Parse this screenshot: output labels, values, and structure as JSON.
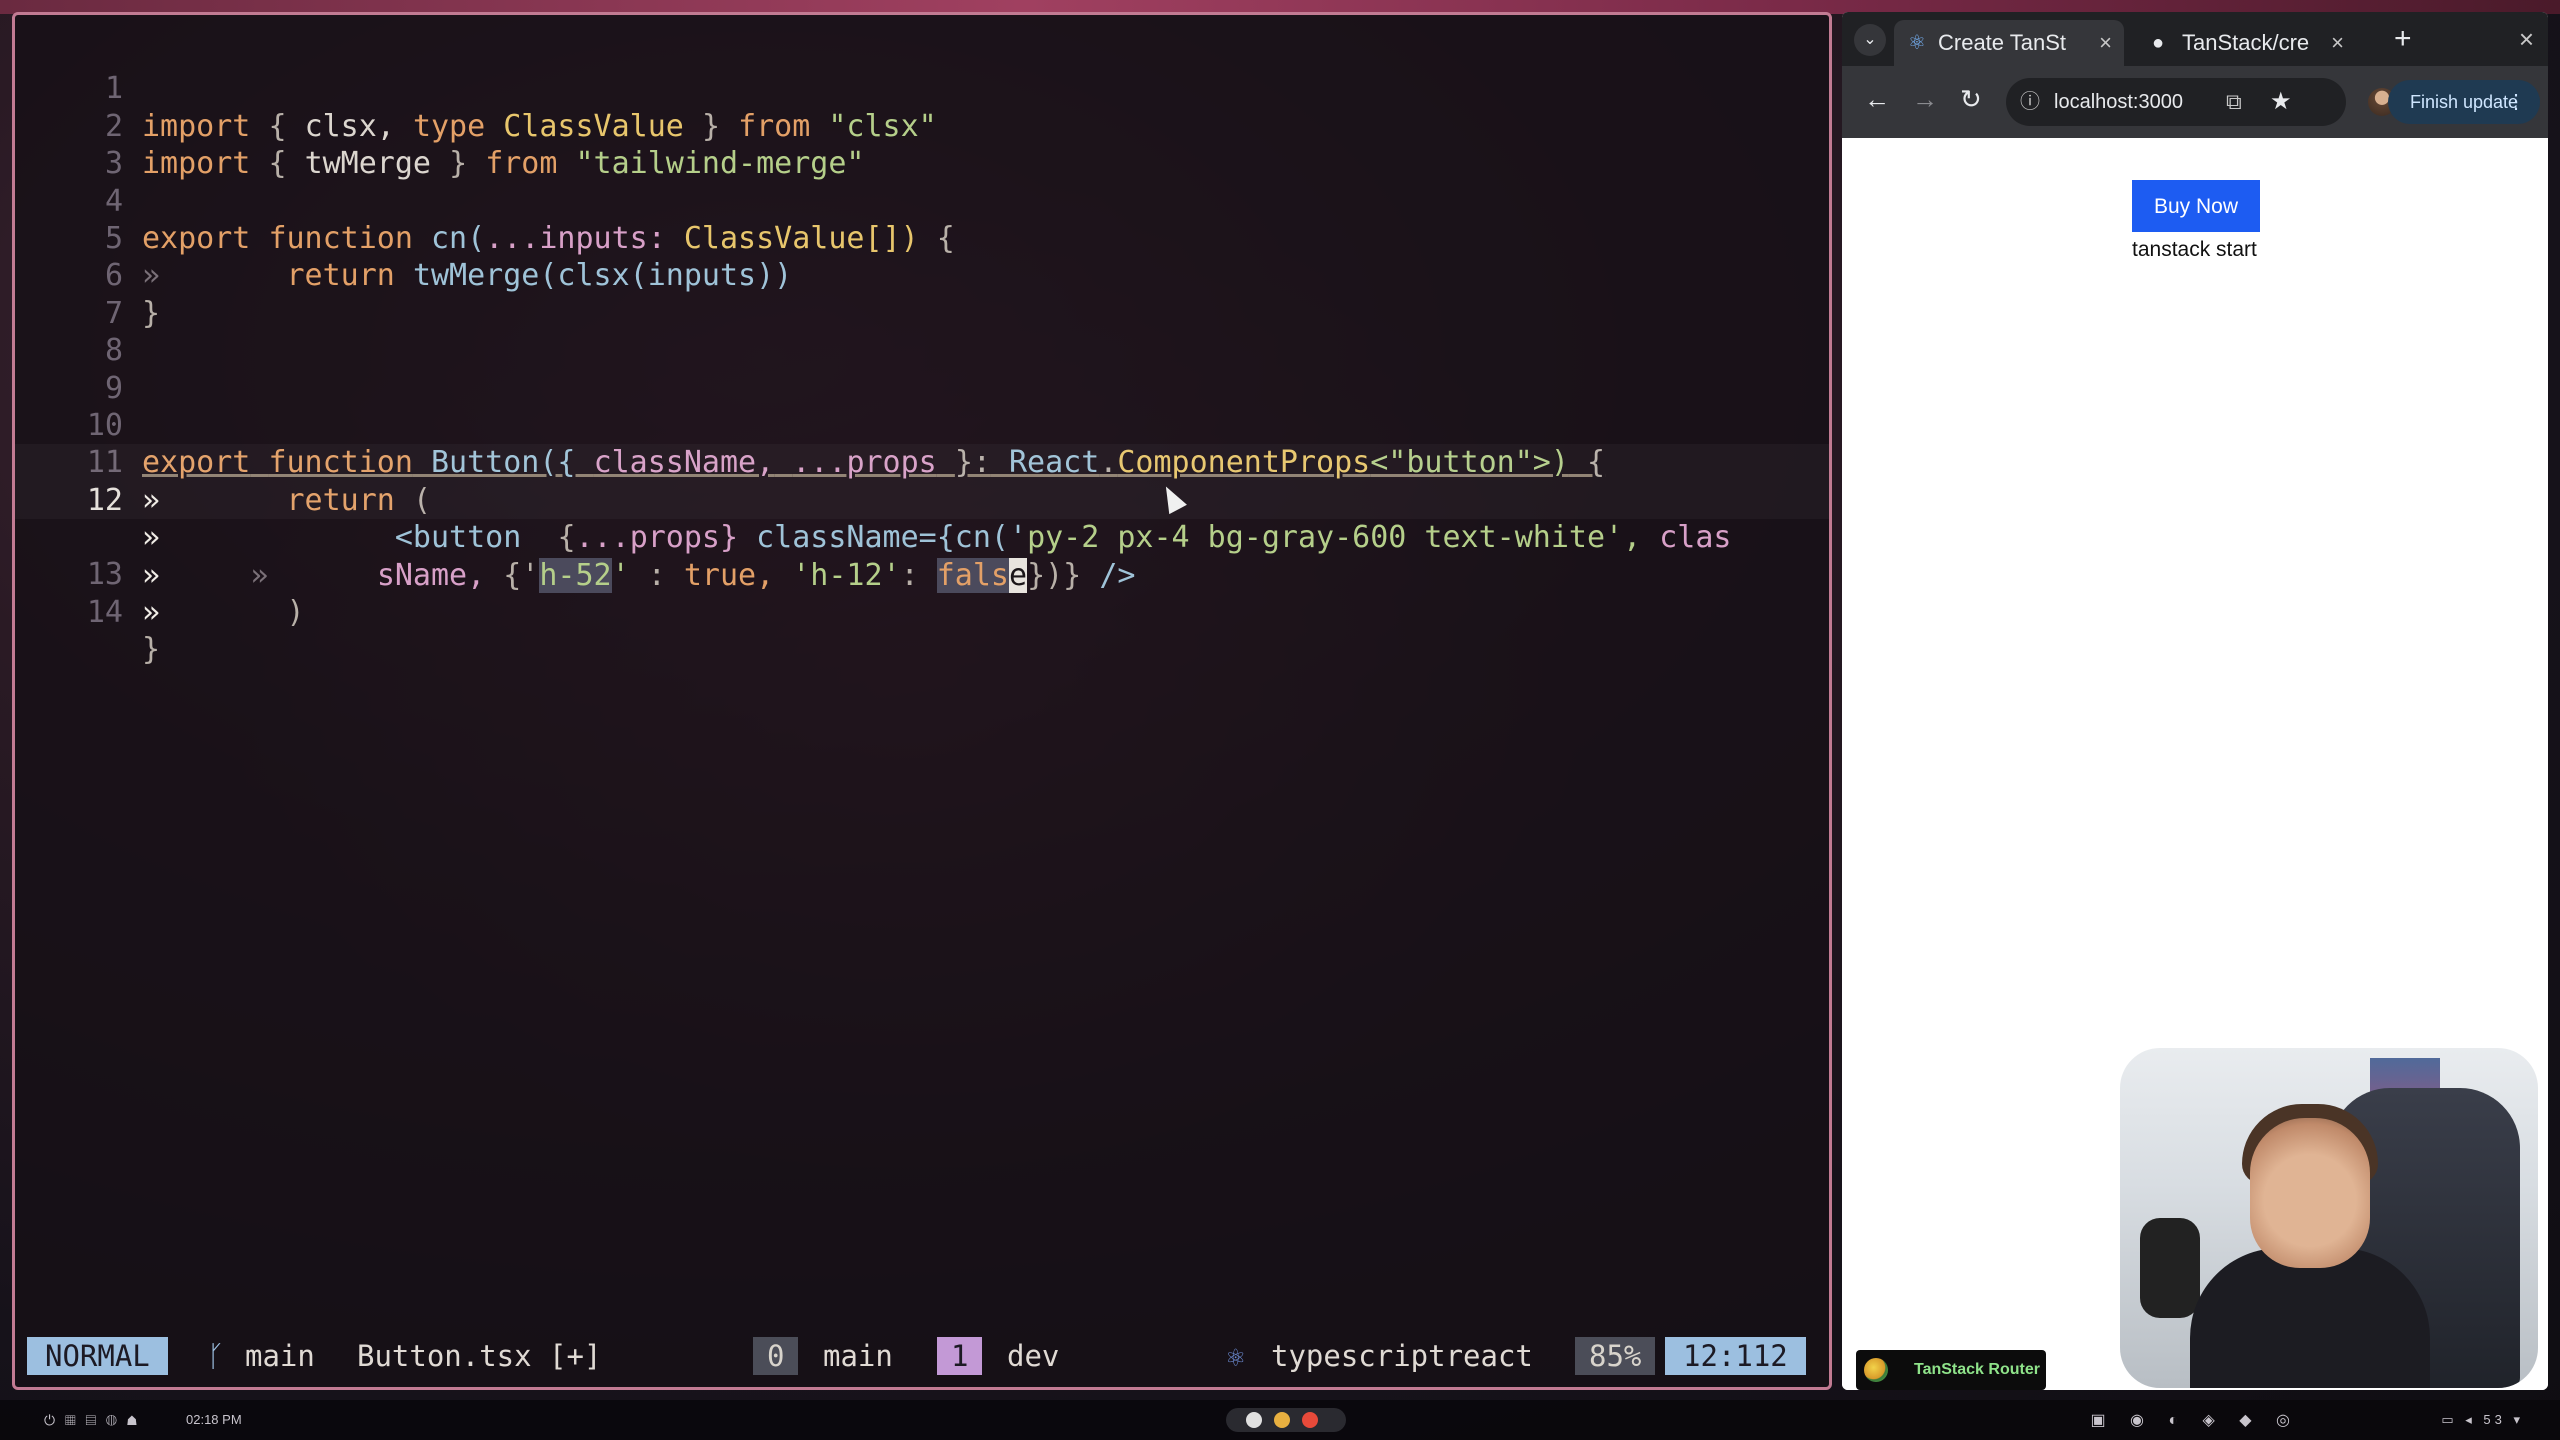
{
  "editor": {
    "lines": [
      {
        "num": "1",
        "tokens": [
          "import",
          "{",
          "clsx,",
          "type",
          "ClassValue",
          "}",
          "from",
          "\"clsx\""
        ]
      },
      {
        "num": "2",
        "tokens": [
          "import",
          "{",
          "twMerge",
          "}",
          "from",
          "\"tailwind-merge\""
        ]
      },
      {
        "num": "3"
      },
      {
        "num": "4",
        "tokens": [
          "export",
          "function",
          "cn(",
          "...",
          "inputs:",
          "ClassValue[])",
          "{"
        ]
      },
      {
        "num": "5",
        "tokens": [
          "»",
          "return",
          "twMerge(clsx(inputs))"
        ]
      },
      {
        "num": "6",
        "tokens": [
          "}"
        ]
      },
      {
        "num": "7"
      },
      {
        "num": "8"
      },
      {
        "num": "9"
      },
      {
        "num": "10",
        "tokens": [
          "export",
          "function",
          "Button({",
          "className,",
          "...",
          "props",
          "}:",
          "React",
          ".",
          "ComponentProps",
          "<\"button\">)",
          "{"
        ]
      },
      {
        "num": "11",
        "tokens": [
          "»",
          "return",
          "("
        ]
      },
      {
        "num": "12",
        "tokens": [
          "»",
          "<button",
          "{",
          "...",
          "props}",
          "className={cn('",
          "py-2 px-4 bg-gray-600 text-white",
          "',",
          "clas"
        ]
      },
      {
        "num": "",
        "tokens": [
          "»",
          "»",
          "sName,",
          "{'",
          "h-52",
          "'",
          ":",
          "true,",
          "'h-12'",
          ":",
          "fals",
          "e",
          "})}",
          "/>"
        ]
      },
      {
        "num": "13",
        "tokens": [
          "»",
          ")"
        ]
      },
      {
        "num": "14",
        "tokens": [
          "}"
        ]
      }
    ]
  },
  "statusline": {
    "mode": "NORMAL",
    "branch_icon": "git-branch-icon",
    "branch": "main",
    "file": "Button.tsx [+]",
    "window0_num": "0",
    "window0_name": "main",
    "window1_num": "1",
    "window1_name": "dev",
    "filetype_icon": "react-icon",
    "filetype": "typescriptreact",
    "percent": "85%",
    "position": "12:112"
  },
  "browser": {
    "tabs": [
      {
        "label": "Create TanSt",
        "icon": "react-icon",
        "close": "×"
      },
      {
        "label": "TanStack/cre",
        "icon": "github-icon",
        "close": "×"
      }
    ],
    "new_tab": "+",
    "window_close": "×",
    "url": "localhost:3000",
    "finish_update": "Finish update",
    "page": {
      "button_label": "Buy Now",
      "text": "tanstack start"
    },
    "devtools_badge": "TanStack Router"
  },
  "taskbar": {
    "clock": "02:18 PM",
    "battery": "53"
  },
  "colors": {
    "accent_border": "#c27b93",
    "mode_bg": "#9cbfe0",
    "window_dev_bg": "#c399d6",
    "buy_button": "#1d5cf2"
  }
}
